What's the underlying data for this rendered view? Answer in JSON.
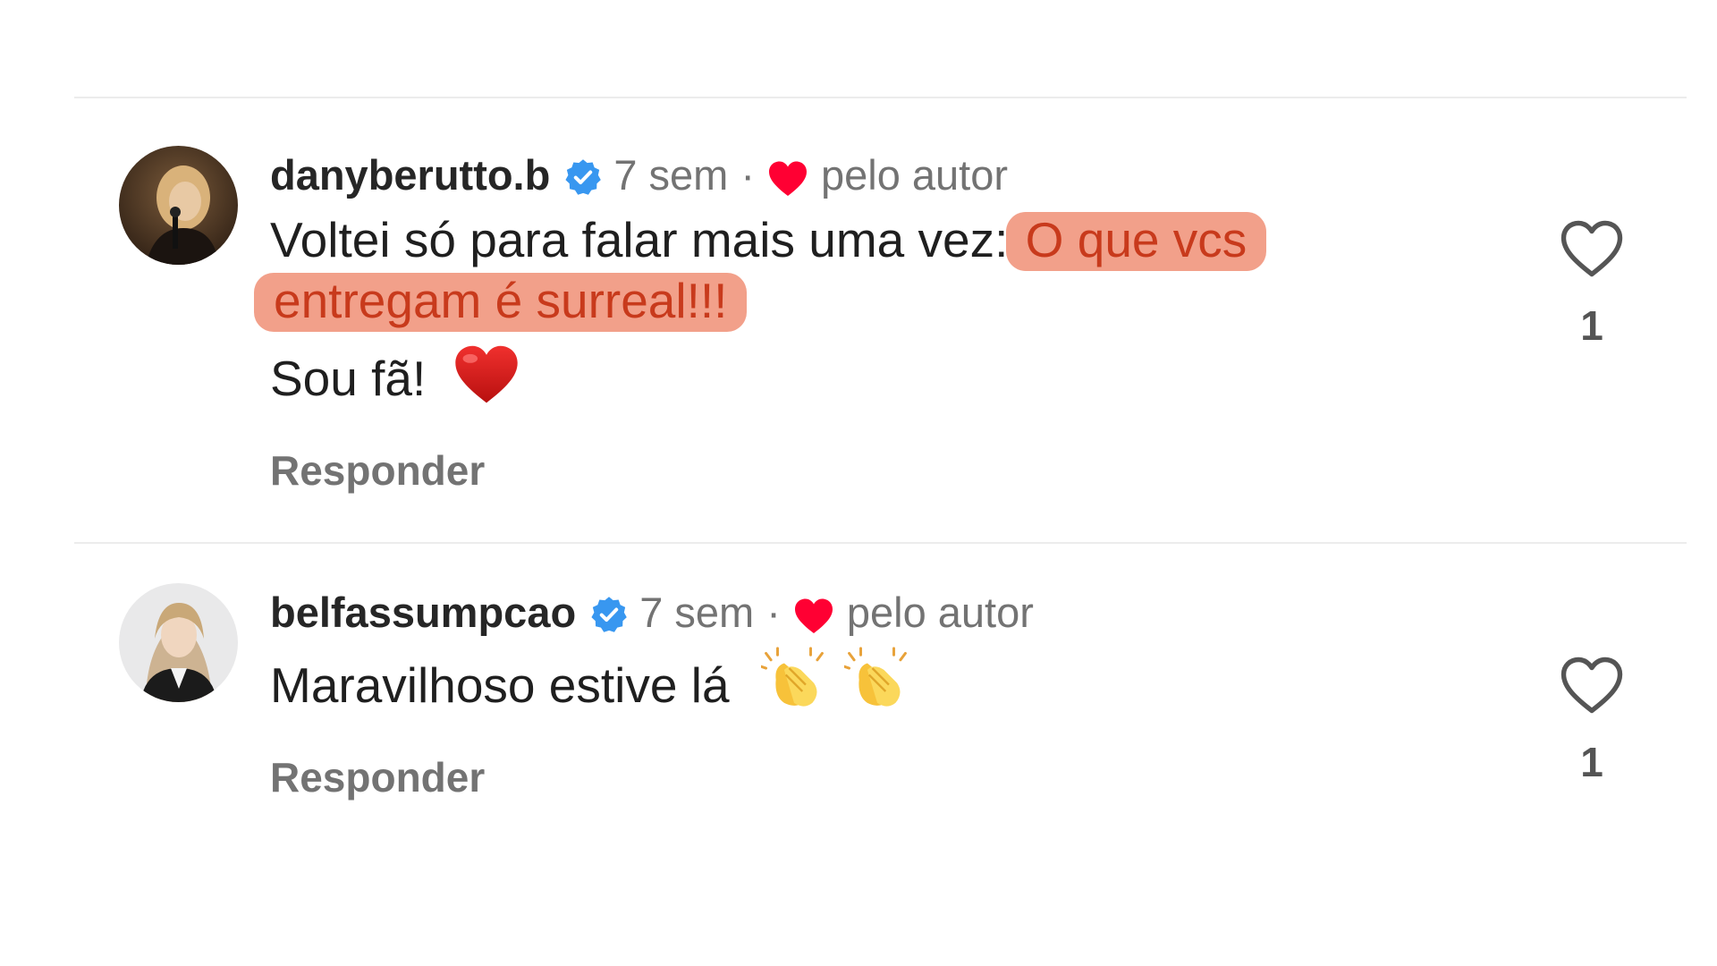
{
  "comments": [
    {
      "username": "danyberutto.b",
      "time": "7 sem",
      "separator": "·",
      "liked_by_author_label": "pelo autor",
      "text_plain": "Voltei só para falar mais uma vez: ",
      "text_highlight": "O que vcs entregam é surreal!!!",
      "text_line2": "Sou fã!",
      "reply_label": "Responder",
      "like_count": "1"
    },
    {
      "username": "belfassumpcao",
      "time": "7 sem",
      "separator": "·",
      "liked_by_author_label": "pelo autor",
      "text_plain": "Maravilhoso estive lá",
      "reply_label": "Responder",
      "like_count": "1"
    }
  ],
  "icons": {
    "verified": "verified-badge-icon",
    "author_heart": "red-heart-icon",
    "like": "heart-outline-icon",
    "emoji_heart": "red-heart-emoji",
    "emoji_clap": "clapping-hands-emoji"
  },
  "colors": {
    "verified_blue": "#3897f0",
    "heart_red": "#ff0033",
    "highlight_bg": "#f2a08a",
    "highlight_text": "#c83a1c",
    "secondary_text": "#737373"
  }
}
